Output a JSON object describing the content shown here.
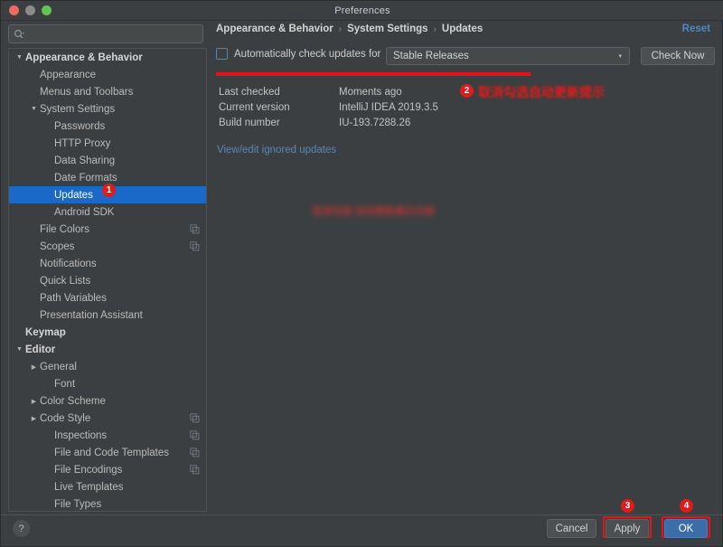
{
  "window": {
    "title": "Preferences",
    "traffic_lights": [
      "close",
      "minimize",
      "zoom"
    ]
  },
  "search": {
    "value": "",
    "placeholder": "",
    "icon": "search-icon"
  },
  "sidebar": {
    "items": [
      {
        "label": "Appearance & Behavior",
        "level": 0,
        "arrow": "▼",
        "bold": true,
        "selected": false,
        "config_icon": false
      },
      {
        "label": "Appearance",
        "level": 1,
        "arrow": "",
        "bold": false,
        "selected": false,
        "config_icon": false
      },
      {
        "label": "Menus and Toolbars",
        "level": 1,
        "arrow": "",
        "bold": false,
        "selected": false,
        "config_icon": false
      },
      {
        "label": "System Settings",
        "level": 1,
        "arrow": "▼",
        "bold": false,
        "selected": false,
        "config_icon": false
      },
      {
        "label": "Passwords",
        "level": 2,
        "arrow": "",
        "bold": false,
        "selected": false,
        "config_icon": false
      },
      {
        "label": "HTTP Proxy",
        "level": 2,
        "arrow": "",
        "bold": false,
        "selected": false,
        "config_icon": false
      },
      {
        "label": "Data Sharing",
        "level": 2,
        "arrow": "",
        "bold": false,
        "selected": false,
        "config_icon": false
      },
      {
        "label": "Date Formats",
        "level": 2,
        "arrow": "",
        "bold": false,
        "selected": false,
        "config_icon": false
      },
      {
        "label": "Updates",
        "level": 2,
        "arrow": "",
        "bold": false,
        "selected": true,
        "config_icon": false
      },
      {
        "label": "Android SDK",
        "level": 2,
        "arrow": "",
        "bold": false,
        "selected": false,
        "config_icon": false
      },
      {
        "label": "File Colors",
        "level": 1,
        "arrow": "",
        "bold": false,
        "selected": false,
        "config_icon": true
      },
      {
        "label": "Scopes",
        "level": 1,
        "arrow": "",
        "bold": false,
        "selected": false,
        "config_icon": true
      },
      {
        "label": "Notifications",
        "level": 1,
        "arrow": "",
        "bold": false,
        "selected": false,
        "config_icon": false
      },
      {
        "label": "Quick Lists",
        "level": 1,
        "arrow": "",
        "bold": false,
        "selected": false,
        "config_icon": false
      },
      {
        "label": "Path Variables",
        "level": 1,
        "arrow": "",
        "bold": false,
        "selected": false,
        "config_icon": false
      },
      {
        "label": "Presentation Assistant",
        "level": 1,
        "arrow": "",
        "bold": false,
        "selected": false,
        "config_icon": false
      },
      {
        "label": "Keymap",
        "level": 0,
        "arrow": "",
        "bold": true,
        "selected": false,
        "config_icon": false
      },
      {
        "label": "Editor",
        "level": 0,
        "arrow": "▼",
        "bold": true,
        "selected": false,
        "config_icon": false
      },
      {
        "label": "General",
        "level": 1,
        "arrow": "▶",
        "bold": false,
        "selected": false,
        "config_icon": false
      },
      {
        "label": "Font",
        "level": 2,
        "arrow": "",
        "bold": false,
        "selected": false,
        "config_icon": false
      },
      {
        "label": "Color Scheme",
        "level": 1,
        "arrow": "▶",
        "bold": false,
        "selected": false,
        "config_icon": false
      },
      {
        "label": "Code Style",
        "level": 1,
        "arrow": "▶",
        "bold": false,
        "selected": false,
        "config_icon": true
      },
      {
        "label": "Inspections",
        "level": 2,
        "arrow": "",
        "bold": false,
        "selected": false,
        "config_icon": true
      },
      {
        "label": "File and Code Templates",
        "level": 2,
        "arrow": "",
        "bold": false,
        "selected": false,
        "config_icon": true
      },
      {
        "label": "File Encodings",
        "level": 2,
        "arrow": "",
        "bold": false,
        "selected": false,
        "config_icon": true
      },
      {
        "label": "Live Templates",
        "level": 2,
        "arrow": "",
        "bold": false,
        "selected": false,
        "config_icon": false
      },
      {
        "label": "File Types",
        "level": 2,
        "arrow": "",
        "bold": false,
        "selected": false,
        "config_icon": false
      }
    ]
  },
  "breadcrumb": {
    "parts": [
      "Appearance & Behavior",
      "System Settings",
      "Updates"
    ],
    "separator": "›"
  },
  "reset": {
    "label": "Reset"
  },
  "updates_page": {
    "auto_check": {
      "checked": false,
      "label": "Automatically check updates for"
    },
    "channel_select": {
      "value": "Stable Releases",
      "arrow": "▾"
    },
    "check_now_label": "Check Now",
    "info": [
      {
        "key": "Last checked",
        "value": "Moments ago"
      },
      {
        "key": "Current version",
        "value": "IntelliJ IDEA 2019.3.5"
      },
      {
        "key": "Build number",
        "value": "IU-193.7288.26"
      }
    ],
    "ignored_updates_link": "View/edit ignored updates"
  },
  "annotations": {
    "badge_1": "1",
    "badge_2": "2",
    "badge_3": "3",
    "badge_4": "4",
    "note_2_text": "取消勾选自动更新提示",
    "blurred_note_text": "取消勾选 自动更新提示内容",
    "highlight_color": "#e4141a"
  },
  "footer": {
    "help_label": "?",
    "cancel_label": "Cancel",
    "apply_label": "Apply",
    "ok_label": "OK"
  },
  "colors": {
    "window_bg": "#3c3f41",
    "selection_blue": "#1a69c8",
    "link_blue": "#4a88c7",
    "annotation_red": "#e4141a",
    "ok_button_blue": "#3b6ea8"
  }
}
